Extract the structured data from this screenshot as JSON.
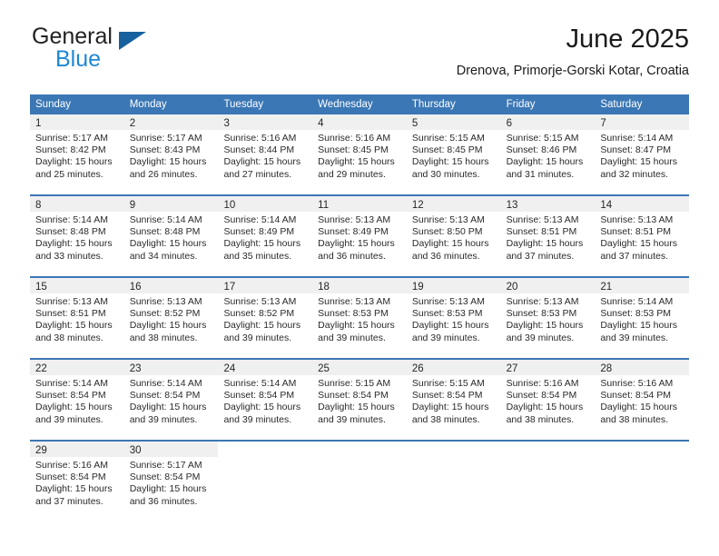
{
  "brand": {
    "line1": "General",
    "line2": "Blue",
    "logo_color": "#17619e",
    "text_color": "#1e88d2"
  },
  "header": {
    "title": "June 2025",
    "subtitle": "Drenova, Primorje-Gorski Kotar, Croatia"
  },
  "theme": {
    "header_blue": "#3b77b5",
    "daynum_band": "#f0f0f0",
    "text": "#2a2a2a"
  },
  "weekdays": [
    "Sunday",
    "Monday",
    "Tuesday",
    "Wednesday",
    "Thursday",
    "Friday",
    "Saturday"
  ],
  "weeks": [
    [
      {
        "day": "1",
        "sunrise": "Sunrise: 5:17 AM",
        "sunset": "Sunset: 8:42 PM",
        "daylight1": "Daylight: 15 hours",
        "daylight2": "and 25 minutes."
      },
      {
        "day": "2",
        "sunrise": "Sunrise: 5:17 AM",
        "sunset": "Sunset: 8:43 PM",
        "daylight1": "Daylight: 15 hours",
        "daylight2": "and 26 minutes."
      },
      {
        "day": "3",
        "sunrise": "Sunrise: 5:16 AM",
        "sunset": "Sunset: 8:44 PM",
        "daylight1": "Daylight: 15 hours",
        "daylight2": "and 27 minutes."
      },
      {
        "day": "4",
        "sunrise": "Sunrise: 5:16 AM",
        "sunset": "Sunset: 8:45 PM",
        "daylight1": "Daylight: 15 hours",
        "daylight2": "and 29 minutes."
      },
      {
        "day": "5",
        "sunrise": "Sunrise: 5:15 AM",
        "sunset": "Sunset: 8:45 PM",
        "daylight1": "Daylight: 15 hours",
        "daylight2": "and 30 minutes."
      },
      {
        "day": "6",
        "sunrise": "Sunrise: 5:15 AM",
        "sunset": "Sunset: 8:46 PM",
        "daylight1": "Daylight: 15 hours",
        "daylight2": "and 31 minutes."
      },
      {
        "day": "7",
        "sunrise": "Sunrise: 5:14 AM",
        "sunset": "Sunset: 8:47 PM",
        "daylight1": "Daylight: 15 hours",
        "daylight2": "and 32 minutes."
      }
    ],
    [
      {
        "day": "8",
        "sunrise": "Sunrise: 5:14 AM",
        "sunset": "Sunset: 8:48 PM",
        "daylight1": "Daylight: 15 hours",
        "daylight2": "and 33 minutes."
      },
      {
        "day": "9",
        "sunrise": "Sunrise: 5:14 AM",
        "sunset": "Sunset: 8:48 PM",
        "daylight1": "Daylight: 15 hours",
        "daylight2": "and 34 minutes."
      },
      {
        "day": "10",
        "sunrise": "Sunrise: 5:14 AM",
        "sunset": "Sunset: 8:49 PM",
        "daylight1": "Daylight: 15 hours",
        "daylight2": "and 35 minutes."
      },
      {
        "day": "11",
        "sunrise": "Sunrise: 5:13 AM",
        "sunset": "Sunset: 8:49 PM",
        "daylight1": "Daylight: 15 hours",
        "daylight2": "and 36 minutes."
      },
      {
        "day": "12",
        "sunrise": "Sunrise: 5:13 AM",
        "sunset": "Sunset: 8:50 PM",
        "daylight1": "Daylight: 15 hours",
        "daylight2": "and 36 minutes."
      },
      {
        "day": "13",
        "sunrise": "Sunrise: 5:13 AM",
        "sunset": "Sunset: 8:51 PM",
        "daylight1": "Daylight: 15 hours",
        "daylight2": "and 37 minutes."
      },
      {
        "day": "14",
        "sunrise": "Sunrise: 5:13 AM",
        "sunset": "Sunset: 8:51 PM",
        "daylight1": "Daylight: 15 hours",
        "daylight2": "and 37 minutes."
      }
    ],
    [
      {
        "day": "15",
        "sunrise": "Sunrise: 5:13 AM",
        "sunset": "Sunset: 8:51 PM",
        "daylight1": "Daylight: 15 hours",
        "daylight2": "and 38 minutes."
      },
      {
        "day": "16",
        "sunrise": "Sunrise: 5:13 AM",
        "sunset": "Sunset: 8:52 PM",
        "daylight1": "Daylight: 15 hours",
        "daylight2": "and 38 minutes."
      },
      {
        "day": "17",
        "sunrise": "Sunrise: 5:13 AM",
        "sunset": "Sunset: 8:52 PM",
        "daylight1": "Daylight: 15 hours",
        "daylight2": "and 39 minutes."
      },
      {
        "day": "18",
        "sunrise": "Sunrise: 5:13 AM",
        "sunset": "Sunset: 8:53 PM",
        "daylight1": "Daylight: 15 hours",
        "daylight2": "and 39 minutes."
      },
      {
        "day": "19",
        "sunrise": "Sunrise: 5:13 AM",
        "sunset": "Sunset: 8:53 PM",
        "daylight1": "Daylight: 15 hours",
        "daylight2": "and 39 minutes."
      },
      {
        "day": "20",
        "sunrise": "Sunrise: 5:13 AM",
        "sunset": "Sunset: 8:53 PM",
        "daylight1": "Daylight: 15 hours",
        "daylight2": "and 39 minutes."
      },
      {
        "day": "21",
        "sunrise": "Sunrise: 5:14 AM",
        "sunset": "Sunset: 8:53 PM",
        "daylight1": "Daylight: 15 hours",
        "daylight2": "and 39 minutes."
      }
    ],
    [
      {
        "day": "22",
        "sunrise": "Sunrise: 5:14 AM",
        "sunset": "Sunset: 8:54 PM",
        "daylight1": "Daylight: 15 hours",
        "daylight2": "and 39 minutes."
      },
      {
        "day": "23",
        "sunrise": "Sunrise: 5:14 AM",
        "sunset": "Sunset: 8:54 PM",
        "daylight1": "Daylight: 15 hours",
        "daylight2": "and 39 minutes."
      },
      {
        "day": "24",
        "sunrise": "Sunrise: 5:14 AM",
        "sunset": "Sunset: 8:54 PM",
        "daylight1": "Daylight: 15 hours",
        "daylight2": "and 39 minutes."
      },
      {
        "day": "25",
        "sunrise": "Sunrise: 5:15 AM",
        "sunset": "Sunset: 8:54 PM",
        "daylight1": "Daylight: 15 hours",
        "daylight2": "and 39 minutes."
      },
      {
        "day": "26",
        "sunrise": "Sunrise: 5:15 AM",
        "sunset": "Sunset: 8:54 PM",
        "daylight1": "Daylight: 15 hours",
        "daylight2": "and 38 minutes."
      },
      {
        "day": "27",
        "sunrise": "Sunrise: 5:16 AM",
        "sunset": "Sunset: 8:54 PM",
        "daylight1": "Daylight: 15 hours",
        "daylight2": "and 38 minutes."
      },
      {
        "day": "28",
        "sunrise": "Sunrise: 5:16 AM",
        "sunset": "Sunset: 8:54 PM",
        "daylight1": "Daylight: 15 hours",
        "daylight2": "and 38 minutes."
      }
    ],
    [
      {
        "day": "29",
        "sunrise": "Sunrise: 5:16 AM",
        "sunset": "Sunset: 8:54 PM",
        "daylight1": "Daylight: 15 hours",
        "daylight2": "and 37 minutes."
      },
      {
        "day": "30",
        "sunrise": "Sunrise: 5:17 AM",
        "sunset": "Sunset: 8:54 PM",
        "daylight1": "Daylight: 15 hours",
        "daylight2": "and 36 minutes."
      },
      {
        "day": "",
        "sunrise": "",
        "sunset": "",
        "daylight1": "",
        "daylight2": ""
      },
      {
        "day": "",
        "sunrise": "",
        "sunset": "",
        "daylight1": "",
        "daylight2": ""
      },
      {
        "day": "",
        "sunrise": "",
        "sunset": "",
        "daylight1": "",
        "daylight2": ""
      },
      {
        "day": "",
        "sunrise": "",
        "sunset": "",
        "daylight1": "",
        "daylight2": ""
      },
      {
        "day": "",
        "sunrise": "",
        "sunset": "",
        "daylight1": "",
        "daylight2": ""
      }
    ]
  ]
}
